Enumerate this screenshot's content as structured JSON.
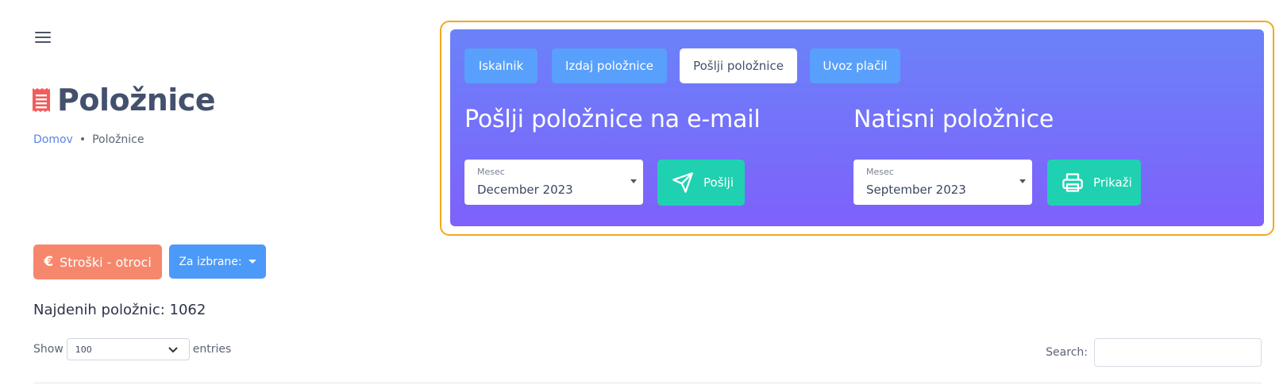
{
  "header": {
    "menu_icon": "hamburger-icon",
    "page_title": "Položnice",
    "title_icon": "receipt-icon",
    "title_icon_color": "#f25c5c"
  },
  "breadcrumb": {
    "home": "Domov",
    "separator": "•",
    "current": "Položnice"
  },
  "panel": {
    "tabs": [
      {
        "label": "Iskalnik",
        "active": false
      },
      {
        "label": "Izdaj položnice",
        "active": false
      },
      {
        "label": "Pošlji položnice",
        "active": true
      },
      {
        "label": "Uvoz plačil",
        "active": false
      }
    ],
    "email_section": {
      "title": "Pošlji položnice na e-mail",
      "select_label": "Mesec",
      "select_value": "December 2023",
      "button_label": "Pošlji",
      "button_icon": "send-icon"
    },
    "print_section": {
      "title": "Natisni položnice",
      "select_label": "Mesec",
      "select_value": "September 2023",
      "button_label": "Prikaži",
      "button_icon": "printer-icon"
    },
    "gradient_colors": [
      "#6b82f9",
      "#7e61fb"
    ],
    "highlight_color": "#f2a81f"
  },
  "actions": {
    "costs_button": "Stroški - otroci",
    "costs_icon": "euro-icon",
    "selected_button": "Za izbrane:"
  },
  "summary": {
    "found_text": "Najdenih položnic: 1062"
  },
  "table_controls": {
    "show_label": "Show",
    "entries_value": "100",
    "entries_label": "entries",
    "search_label": "Search:",
    "search_value": ""
  },
  "colors": {
    "accent_teal": "#1fd1b1",
    "tab_blue": "#58a0fb",
    "costs_orange": "#f6876c",
    "selected_blue": "#4b9af9",
    "link_blue": "#5b84e8"
  }
}
